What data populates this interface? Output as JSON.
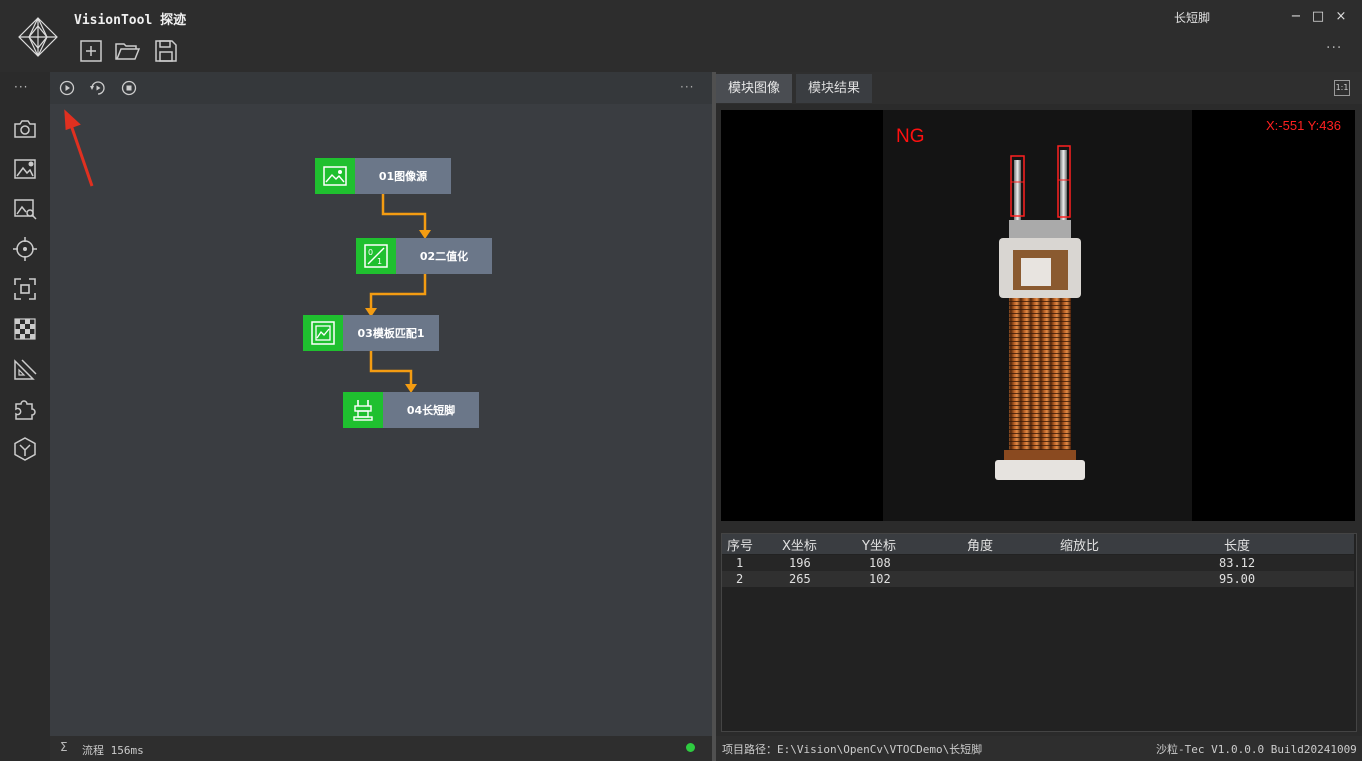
{
  "app": {
    "title": "VisionTool 探迹",
    "document_title": "长短脚",
    "window_controls": {
      "minimize": "−",
      "maximize": "□",
      "close": "×"
    },
    "more": "···"
  },
  "toolbar_icons": [
    "new-icon",
    "open-folder-icon",
    "save-icon"
  ],
  "sidebar": {
    "more": "···",
    "icons": [
      "camera-icon",
      "image-settings-icon",
      "image-search-icon",
      "target-icon",
      "focus-frame-icon",
      "checkerboard-icon",
      "ruler-icon",
      "puzzle-icon",
      "hexagon-icon"
    ]
  },
  "canvas_toolbar": {
    "icons": [
      "run-icon",
      "loop-run-icon",
      "stop-icon"
    ],
    "more": "···"
  },
  "flow": {
    "nodes": [
      {
        "label": "01图像源",
        "icon": "image-icon"
      },
      {
        "label": "02二值化",
        "icon": "binarize-icon"
      },
      {
        "label": "03模板匹配1",
        "icon": "template-match-icon"
      },
      {
        "label": "04长短脚",
        "icon": "pin-length-icon"
      }
    ],
    "wire_color": "#f39c12"
  },
  "annotation_color": "#e03020",
  "left_status": {
    "sigma": "Σ",
    "flow_time": "流程 156ms",
    "status_color": "#2ecc40"
  },
  "right_panel": {
    "tabs": [
      "模块图像",
      "模块结果"
    ],
    "fit_label": "1:1",
    "image": {
      "result": "NG",
      "coordinate": "X:-551 Y:436",
      "result_color": "#ff1010"
    },
    "table": {
      "headers": [
        "序号",
        "X坐标",
        "Y坐标",
        "角度",
        "缩放比",
        "长度"
      ],
      "rows": [
        [
          "1",
          "196",
          "108",
          "",
          "",
          "83.12"
        ],
        [
          "2",
          "265",
          "102",
          "",
          "",
          "95.00"
        ]
      ]
    }
  },
  "right_status": {
    "project_path": "项目路径：E:\\Vision\\OpenCv\\VTOCDemo\\长短脚",
    "version": "沙粒-Tec V1.0.0.0 Build20241009"
  }
}
